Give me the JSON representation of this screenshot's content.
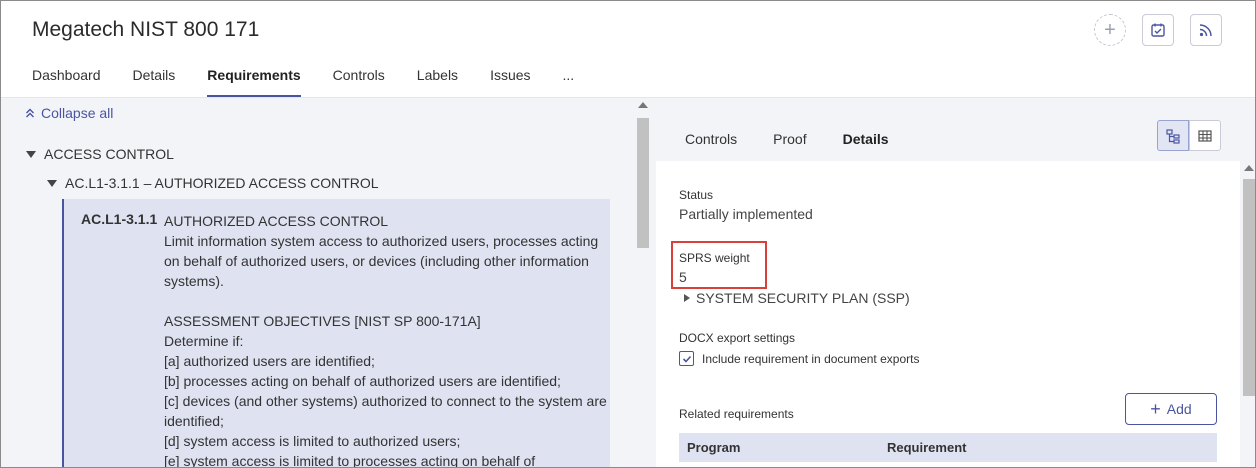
{
  "header": {
    "title": "Megatech NIST 800 171",
    "plus_glyph": "+",
    "icons": [
      "plus-icon",
      "calendar-check-icon",
      "rss-feed-icon"
    ]
  },
  "tabs": [
    {
      "label": "Dashboard",
      "active": false
    },
    {
      "label": "Details",
      "active": false
    },
    {
      "label": "Requirements",
      "active": true
    },
    {
      "label": "Controls",
      "active": false
    },
    {
      "label": "Labels",
      "active": false
    },
    {
      "label": "Issues",
      "active": false
    },
    {
      "label": "...",
      "active": false
    }
  ],
  "left": {
    "collapse_label": "Collapse all",
    "tree_level1": "ACCESS CONTROL",
    "tree_level2": "AC.L1-3.1.1 – AUTHORIZED ACCESS CONTROL",
    "requirement": {
      "code": "AC.L1-3.1.1",
      "title": "AUTHORIZED ACCESS CONTROL",
      "description": "Limit information system access to authorized users, processes acting on behalf of authorized users, or devices (including other information systems).",
      "objectives_heading": "ASSESSMENT OBJECTIVES [NIST SP 800-171A]",
      "determine": "Determine if:",
      "objectives": [
        "[a] authorized users are identified;",
        "[b] processes acting on behalf of authorized users are identified;",
        "[c] devices (and other systems) authorized to connect to the system are identified;",
        "[d] system access is limited to authorized users;",
        "[e] system access is limited to processes acting on behalf of"
      ]
    }
  },
  "right": {
    "tabs": [
      {
        "label": "Controls",
        "active": false
      },
      {
        "label": "Proof",
        "active": false
      },
      {
        "label": "Details",
        "active": true
      }
    ],
    "view_icons": [
      "tree-view-icon",
      "table-view-icon"
    ],
    "status_label": "Status",
    "status_value": "Partially implemented",
    "sprs_label": "SPRS weight",
    "sprs_value": "5",
    "ssp_label": "SYSTEM SECURITY PLAN (SSP)",
    "docx_label": "DOCX export settings",
    "include_label": "Include requirement in document exports",
    "include_checked": true,
    "related_label": "Related requirements",
    "add_label": "Add",
    "add_glyph": "+",
    "table_headers": [
      "Program",
      "Requirement"
    ]
  },
  "colors": {
    "accent": "#4a55a2",
    "highlight_border": "#d9403a",
    "panel_bg": "#f3f4f8",
    "selected_card_bg": "#dfe2f1"
  }
}
